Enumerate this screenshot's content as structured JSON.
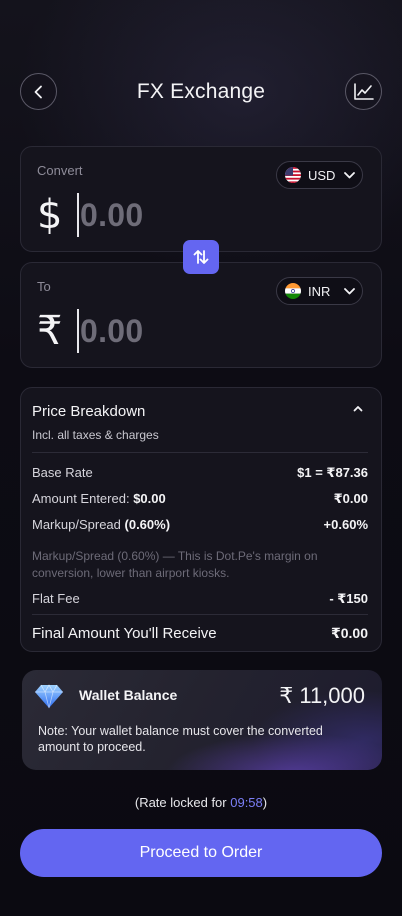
{
  "header": {
    "title": "FX Exchange",
    "back_icon": "chevron-left-icon",
    "chart_icon": "line-chart-icon"
  },
  "convert": {
    "label": "Convert",
    "currency_code": "USD",
    "currency_flag": "us-flag-icon",
    "symbol": "$",
    "amount": "0.00"
  },
  "to": {
    "label": "To",
    "currency_code": "INR",
    "currency_flag": "india-flag-icon",
    "symbol": "₹",
    "amount": "0.00"
  },
  "swap": {
    "icon": "swap-vertical-icon"
  },
  "breakdown": {
    "title": "Price Breakdown",
    "subtitle": "Incl. all taxes & charges",
    "rows": [
      {
        "label": "Base Rate",
        "value": "$1 = ₹87.36"
      },
      {
        "label": "Amount Entered:",
        "label_strong": "$0.00",
        "value": "₹0.00"
      },
      {
        "label": "Markup/Spread",
        "label_strong": "(0.60%)",
        "value": "+0.60%"
      }
    ],
    "note": "Markup/Spread (0.60%) — This is Dot.Pe's margin on conversion, lower than airport kiosks.",
    "fee": {
      "label": "Flat Fee",
      "value": "- ₹150"
    },
    "final": {
      "label": "Final Amount You'll Receive",
      "value": "₹0.00"
    }
  },
  "wallet": {
    "label": "Wallet Balance",
    "amount": "₹ 11,000",
    "note": "Note: Your wallet balance must cover the converted amount to proceed."
  },
  "rate_lock": {
    "prefix": "(Rate locked for ",
    "timer": "09:58",
    "suffix": ")"
  },
  "proceed_label": "Proceed to Order",
  "colors": {
    "accent": "#6366f1",
    "background": "#0d0c14",
    "card": "#15141d",
    "timer": "#7c7ff7"
  }
}
